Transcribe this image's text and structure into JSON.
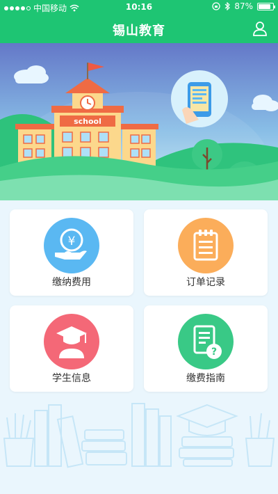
{
  "status_bar": {
    "carrier": "中国移动",
    "time": "10:16",
    "battery": "87%",
    "battery_level": 0.87
  },
  "navbar": {
    "title": "锡山教育"
  },
  "banner": {
    "sign_text": "school"
  },
  "menu": [
    {
      "label": "缴纳费用",
      "icon": "yen-hand-icon",
      "color": "#5ab8f2"
    },
    {
      "label": "订单记录",
      "icon": "notepad-icon",
      "color": "#fbad5a"
    },
    {
      "label": "学生信息",
      "icon": "graduate-icon",
      "color": "#f46877"
    },
    {
      "label": "缴费指南",
      "icon": "document-question-icon",
      "color": "#39c986"
    }
  ],
  "colors": {
    "primary": "#1ec573",
    "background": "#eaf6fd"
  }
}
